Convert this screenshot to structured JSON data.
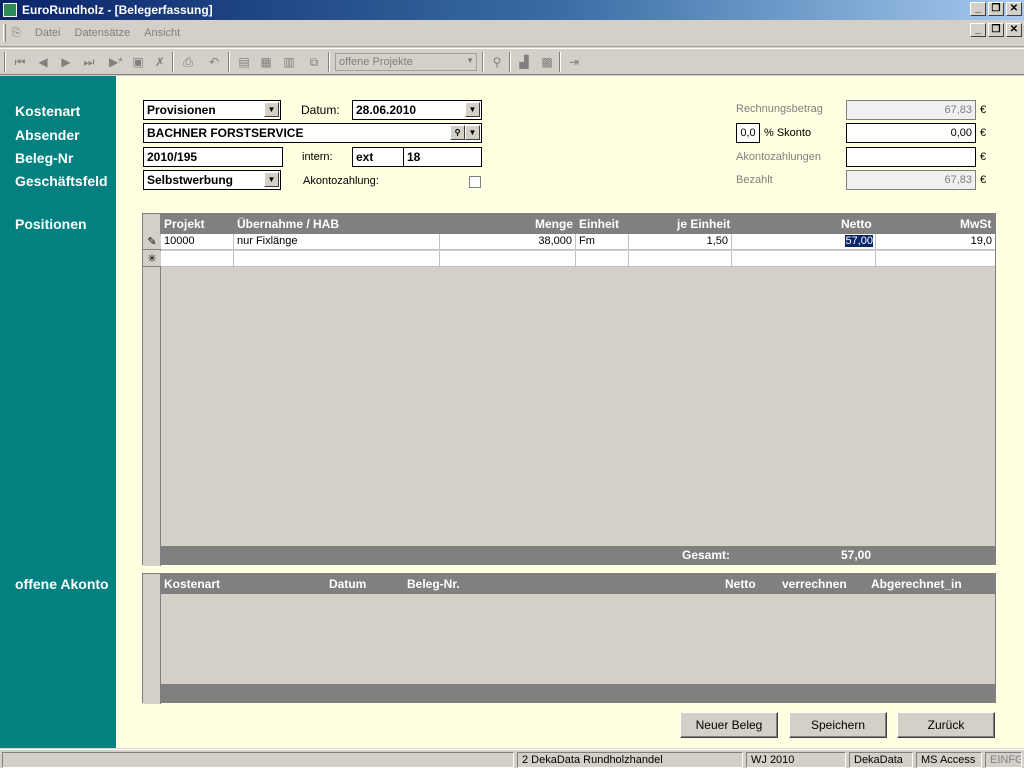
{
  "window": {
    "title": "EuroRundholz - [Belegerfassung]"
  },
  "menu": {
    "items": [
      "Datei",
      "Datensätze",
      "Ansicht"
    ]
  },
  "toolbar": {
    "filter_combo": "offene Projekte"
  },
  "sidebar": {
    "labels": {
      "kostenart": "Kostenart",
      "absender": "Absender",
      "beleg_nr": "Beleg-Nr",
      "geschaeftsfeld": "Geschäftsfeld",
      "positionen": "Positionen",
      "offene_akonto": "offene Akonto"
    }
  },
  "form": {
    "kostenart": "Provisionen",
    "datum_label": "Datum:",
    "datum": "28.06.2010",
    "absender": "BACHNER FORSTSERVICE",
    "beleg_nr": "2010/195",
    "intern_label": "intern:",
    "intern_prefix": "ext",
    "intern_nr": "18",
    "geschaeftsfeld": "Selbstwerbung",
    "akontozahlung_label": "Akontozahlung:",
    "rechnungsbetrag_label": "Rechnungsbetrag",
    "rechnungsbetrag": "67,83",
    "skonto_pct": "0,0",
    "skonto_label": "% Skonto",
    "skonto": "0,00",
    "akontozahlungen_label": "Akontozahlungen",
    "akontozahlungen": "",
    "bezahlt_label": "Bezahlt",
    "bezahlt": "67,83",
    "currency": "€"
  },
  "positionen": {
    "columns": [
      "Projekt",
      "Übernahme / HAB",
      "Menge",
      "Einheit",
      "je Einheit",
      "Netto",
      "MwSt"
    ],
    "rows": [
      {
        "projekt": "10000",
        "uebernahme": "nur Fixlänge",
        "menge": "38,000",
        "einheit": "Fm",
        "je_einheit": "1,50",
        "netto": "57,00",
        "mwst": "19,0"
      }
    ],
    "gesamt_label": "Gesamt:",
    "gesamt": "57,00"
  },
  "akonto": {
    "columns": [
      "Kostenart",
      "Datum",
      "Beleg-Nr.",
      "Netto",
      "verrechnen",
      "Abgerechnet_in"
    ]
  },
  "buttons": {
    "neuer_beleg": "Neuer Beleg",
    "speichern": "Speichern",
    "zurueck": "Zurück"
  },
  "status": {
    "company": "2 DekaData Rundholzhandel",
    "year": "WJ 2010",
    "vendor": "DekaData",
    "db": "MS Access",
    "mode": "EINFG"
  },
  "colors": {
    "sidebar": "#038080",
    "content": "#ffffe1",
    "title_start": "#0a246a",
    "grid_header": "#808080"
  }
}
